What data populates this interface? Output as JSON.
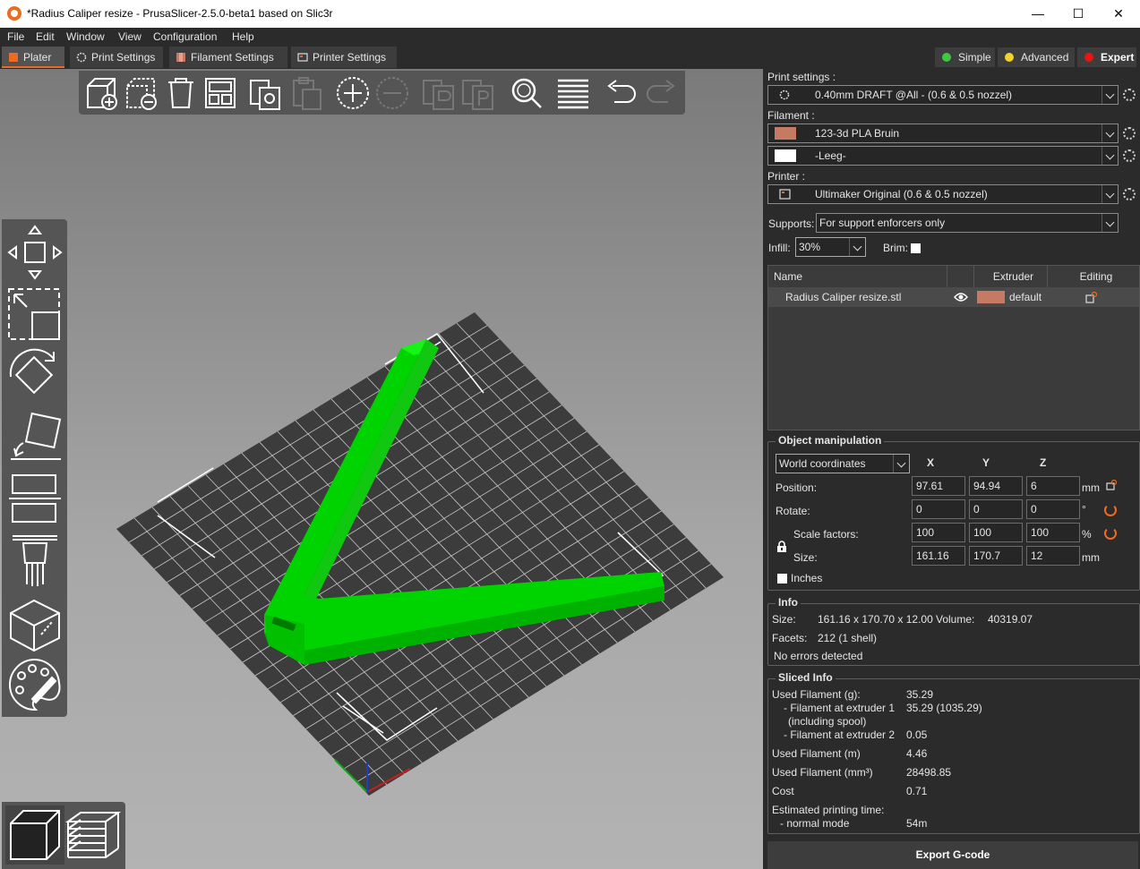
{
  "window": {
    "title": "*Radius Caliper resize - PrusaSlicer-2.5.0-beta1 based on Slic3r",
    "minimize": "—",
    "maximize": "☐",
    "close": "✕"
  },
  "menu": [
    "File",
    "Edit",
    "Window",
    "View",
    "Configuration",
    "Help"
  ],
  "tabs": [
    {
      "label": "Plater",
      "active": true
    },
    {
      "label": "Print Settings"
    },
    {
      "label": "Filament Settings"
    },
    {
      "label": "Printer Settings"
    }
  ],
  "modes": [
    {
      "label": "Simple",
      "color": "#3fc83f"
    },
    {
      "label": "Advanced",
      "color": "#f2d22c"
    },
    {
      "label": "Expert",
      "color": "#e81515",
      "active": true
    }
  ],
  "sidebar": {
    "print_settings_label": "Print settings :",
    "print_settings_value": "0.40mm DRAFT @All - (0.6 & 0.5 nozzel)",
    "filament_label": "Filament :",
    "filament1_value": "123-3d PLA Bruin",
    "filament1_color": "#c77a63",
    "filament2_value": "-Leeg-",
    "filament2_color": "#ffffff",
    "printer_label": "Printer :",
    "printer_value": "Ultimaker Original (0.6 & 0.5 nozzel)",
    "supports_label": "Supports:",
    "supports_value": "For support enforcers only",
    "infill_label": "Infill:",
    "infill_value": "30%",
    "brim_label": "Brim:"
  },
  "object_list": {
    "headers": {
      "name": "Name",
      "extruder": "Extruder",
      "editing": "Editing"
    },
    "rows": [
      {
        "name": "Radius Caliper resize.stl",
        "extruder": "default",
        "extruder_color": "#c77a63"
      }
    ]
  },
  "object_manipulation": {
    "title": "Object manipulation",
    "coord_system": "World coordinates",
    "axes": [
      "X",
      "Y",
      "Z"
    ],
    "position_label": "Position:",
    "position": [
      "97.61",
      "94.94",
      "6"
    ],
    "position_unit": "mm",
    "rotate_label": "Rotate:",
    "rotate": [
      "0",
      "0",
      "0"
    ],
    "rotate_unit": "°",
    "scale_label": "Scale factors:",
    "scale": [
      "100",
      "100",
      "100"
    ],
    "scale_unit": "%",
    "size_label": "Size:",
    "size": [
      "161.16",
      "170.7",
      "12"
    ],
    "size_unit": "mm",
    "inches_label": "Inches"
  },
  "info": {
    "title": "Info",
    "size_label": "Size:",
    "size_value": "161.16 x 170.70 x 12.00",
    "volume_label": "Volume:",
    "volume_value": "40319.07",
    "facets_label": "Facets:",
    "facets_value": "212 (1 shell)",
    "errors": "No errors detected"
  },
  "sliced_info": {
    "title": "Sliced Info",
    "rows": [
      {
        "label": "Used Filament (g):",
        "value": "35.29"
      },
      {
        "label": "- Filament at extruder 1",
        "value": "35.29 (1035.29)"
      },
      {
        "label": "(including spool)",
        "value": ""
      },
      {
        "label": "- Filament at extruder 2",
        "value": "0.05"
      },
      {
        "label": "Used Filament (m)",
        "value": "4.46"
      },
      {
        "label": "Used Filament (mm³)",
        "value": "28498.85"
      },
      {
        "label": "Cost",
        "value": "0.71"
      },
      {
        "label": "Estimated printing time:",
        "value": ""
      },
      {
        "label": "- normal mode",
        "value": "54m"
      }
    ]
  },
  "export_label": "Export G-code",
  "colors": {
    "accent": "#ed6b21",
    "model": "#00e000",
    "bed": "#3c3c3c",
    "panel": "#2b2b2b"
  },
  "icons": {
    "toolbar_top": [
      "add-icon",
      "delete-icon",
      "delete-all-icon",
      "arrange-icon",
      "copy-icon",
      "paste-icon",
      "add-instance-icon",
      "remove-instance-icon",
      "split-objects-icon",
      "split-parts-icon",
      "search-icon",
      "layers-editing-icon",
      "undo-icon",
      "redo-icon"
    ],
    "toolbar_left": [
      "move-icon",
      "scale-icon",
      "rotate-icon",
      "place-on-face-icon",
      "cut-icon",
      "support-paint-icon",
      "seam-paint-icon",
      "mmu-paint-icon"
    ],
    "view": [
      "3d-view-icon",
      "preview-icon"
    ]
  }
}
